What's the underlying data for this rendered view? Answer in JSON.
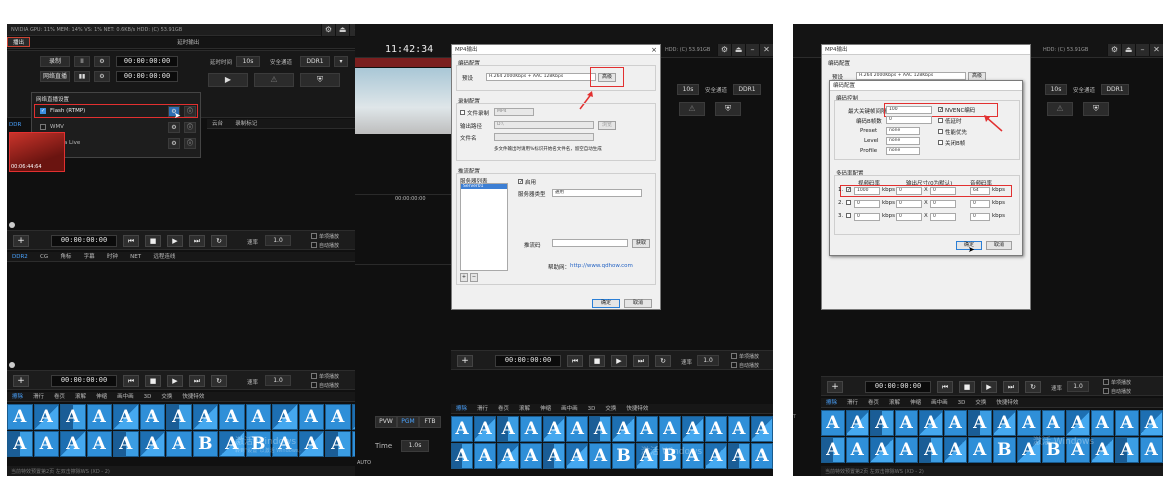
{
  "panel1": {
    "status": "NVIDIA GPU: 11%   MEM: 14%   VS: 1%   NET: 0.6KB/s   HDD: (C) 53.91GB",
    "broadcast_tab": "播出",
    "delay_tab": "延时输出",
    "record_label": "录制",
    "stream_label": "网络直播",
    "pause_icon": "II",
    "time": "00:00:00:00",
    "delay_time_label": "延时时间",
    "delay_time_value": "10s",
    "safe_channel_label": "安全通道",
    "safe_channel_value": "DDR1",
    "popup": {
      "title": "网络直播设置",
      "items": [
        {
          "label": "Flash (RTMP)",
          "checked": true
        },
        {
          "label": "WMV",
          "checked": false
        },
        {
          "label": "Nvidia Live",
          "checked": false
        }
      ]
    },
    "clip_tab": "DDR",
    "clip_time": "00:06:44:64",
    "tab_cloud": "云台",
    "tab_record_mark": "录制标记",
    "ddr2_tabs": [
      "DDR2",
      "CG",
      "角标",
      "字幕",
      "时钟",
      "NET",
      "远程连线"
    ],
    "speed_label": "速率",
    "speed_value": "1.0",
    "single_play": "单项播放",
    "auto_play": "自动播放",
    "fx_tabs": [
      "擦除",
      "滑行",
      "卷页",
      "滚解",
      "伸缩",
      "画中画",
      "3D",
      "交换",
      "快捷特效"
    ],
    "footer": "当前特效预置第2页 左双击擦除WS (XD - 2)",
    "watermark": "激活 Windows",
    "watermark_sub": "转到\"设置\"以激活 Windows。"
  },
  "panel2": {
    "clock": "11:42:34",
    "status": "HDD: (C) 53.91GB",
    "dialog": {
      "title": "MP4输出",
      "encode_group": "编码配置",
      "preset_label": "预设",
      "preset_value": "H.264 2000Kbps + AAC 128Kbps",
      "advanced_button": "高级",
      "record_group": "录制配置",
      "file_record": "文件录制",
      "file_record_value": "MP4",
      "output_path_label": "输出路径",
      "output_path_value": "D:\\",
      "browse_button": "浏览",
      "file_name_label": "文件名",
      "hint": "多文件输出时请用%标识开始名文件名，留空自动生成",
      "push_group": "推流配置",
      "server_list_label": "服务器列表",
      "server_item": "Server01",
      "enable_label": "启用",
      "server_type_label": "服务器类型",
      "server_type_value": "通用",
      "push_code_label": "推流码",
      "get_button": "获取",
      "help_label": "帮助网：",
      "help_url": "http://www.qdhow.com",
      "ok_button": "确定",
      "cancel_button": "取消"
    },
    "delay_time_value": "10s",
    "safe_channel_label": "安全通道",
    "safe_channel_value": "DDR1",
    "time": "00:00:00:00",
    "speed_label": "速率",
    "speed_value": "1.0",
    "single_play": "单项播放",
    "auto_play": "自动播放",
    "fx_tabs": [
      "擦除",
      "滑行",
      "卷页",
      "滚解",
      "伸缩",
      "画中画",
      "3D",
      "交换",
      "快捷特效"
    ],
    "pvw": "PVW",
    "pgm": "PGM",
    "ftb": "FTB",
    "time_label": "Time",
    "time_value": "1.0s",
    "auto_label": "AUTO",
    "watermark": "激活 Windows"
  },
  "panel3": {
    "status": "HDD: (C) 53.91GB",
    "dialog": {
      "title": "MP4输出",
      "encode_group": "编码配置",
      "preset_label": "预设",
      "preset_value": "H.264 2000Kbps + AAC 128Kbps",
      "advanced_button": "高级",
      "inner_title": "编码配置",
      "rate_control_group": "编码控制",
      "max_keyframe_label": "最大关键帧间隔",
      "max_keyframe_value": "100",
      "b_frames_label": "编码B帧数",
      "b_frames_value": "0",
      "preset_row_label": "Preset",
      "level_label": "Level",
      "profile_label": "Profile",
      "none_value": "none",
      "cb_hw": "NVENC编码",
      "cb_lowlat": "低延时",
      "cb_perf": "性能优先",
      "cb_close": "关闭B帧",
      "multi_group": "多码率配置",
      "video_bitrate_label": "视频码率",
      "output_size_label": "输出尺寸(0为默认)",
      "audio_bitrate_label": "音频码率",
      "rows": [
        {
          "idx": "1.",
          "checked": true,
          "vbr": "1000",
          "w": "0",
          "h": "0",
          "abr": "64"
        },
        {
          "idx": "2.",
          "checked": false,
          "vbr": "0",
          "w": "0",
          "h": "0",
          "abr": "0"
        },
        {
          "idx": "3.",
          "checked": false,
          "vbr": "0",
          "w": "0",
          "h": "0",
          "abr": "0"
        }
      ],
      "kbps": "kbps",
      "times": "X",
      "ok_button": "确定",
      "cancel_button": "取消"
    },
    "delay_time_value": "10s",
    "safe_channel_label": "安全通道",
    "safe_channel_value": "DDR1",
    "time": "00:00:00:00",
    "speed_label": "速率",
    "speed_value": "1.0",
    "single_play": "单项播放",
    "auto_play": "自动播放",
    "fx_tabs": [
      "擦除",
      "滑行",
      "卷页",
      "滚解",
      "伸缩",
      "画中画",
      "3D",
      "交换",
      "快捷特效"
    ],
    "footer": "当前特效预置第2页 左双击擦除WS (XD - 2)",
    "watermark": "激活 Windows"
  },
  "colors": {
    "annotation_red": "#e23030",
    "tile_blue": "#2f8fd8",
    "accent_blue": "#4aa3ff"
  }
}
